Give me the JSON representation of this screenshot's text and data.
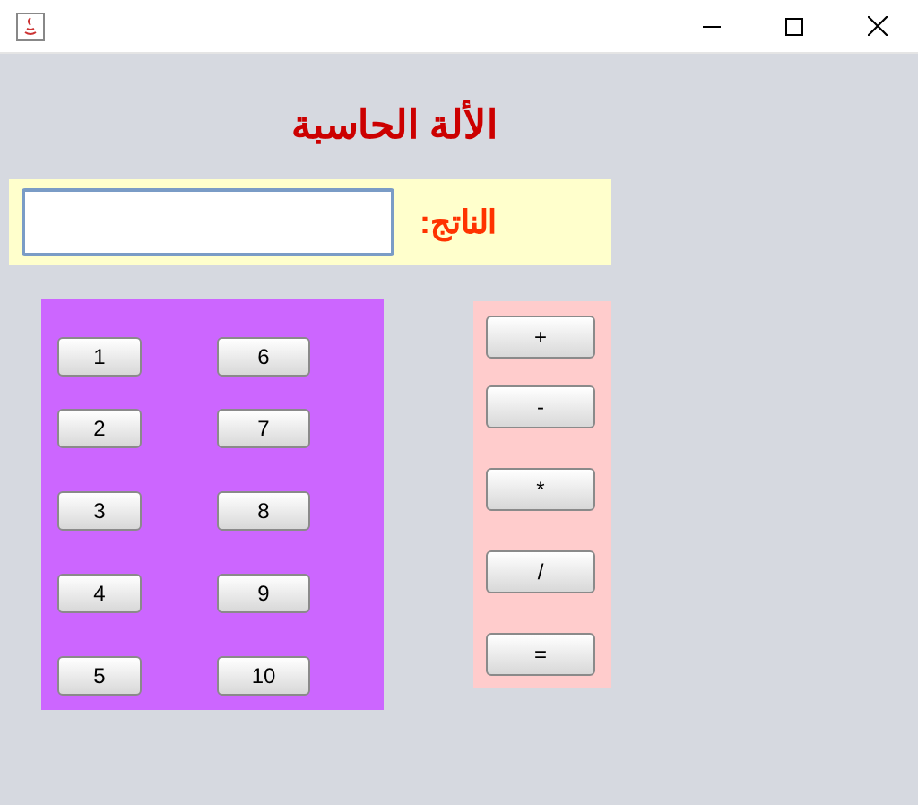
{
  "heading": "الألة الحاسبة",
  "result": {
    "label": "الناتج:"
  },
  "number_buttons": [
    "6",
    "1",
    "7",
    "2",
    "8",
    "3",
    "9",
    "4",
    "10",
    "5"
  ],
  "operators": [
    "+",
    "-",
    "*",
    "/",
    "="
  ]
}
